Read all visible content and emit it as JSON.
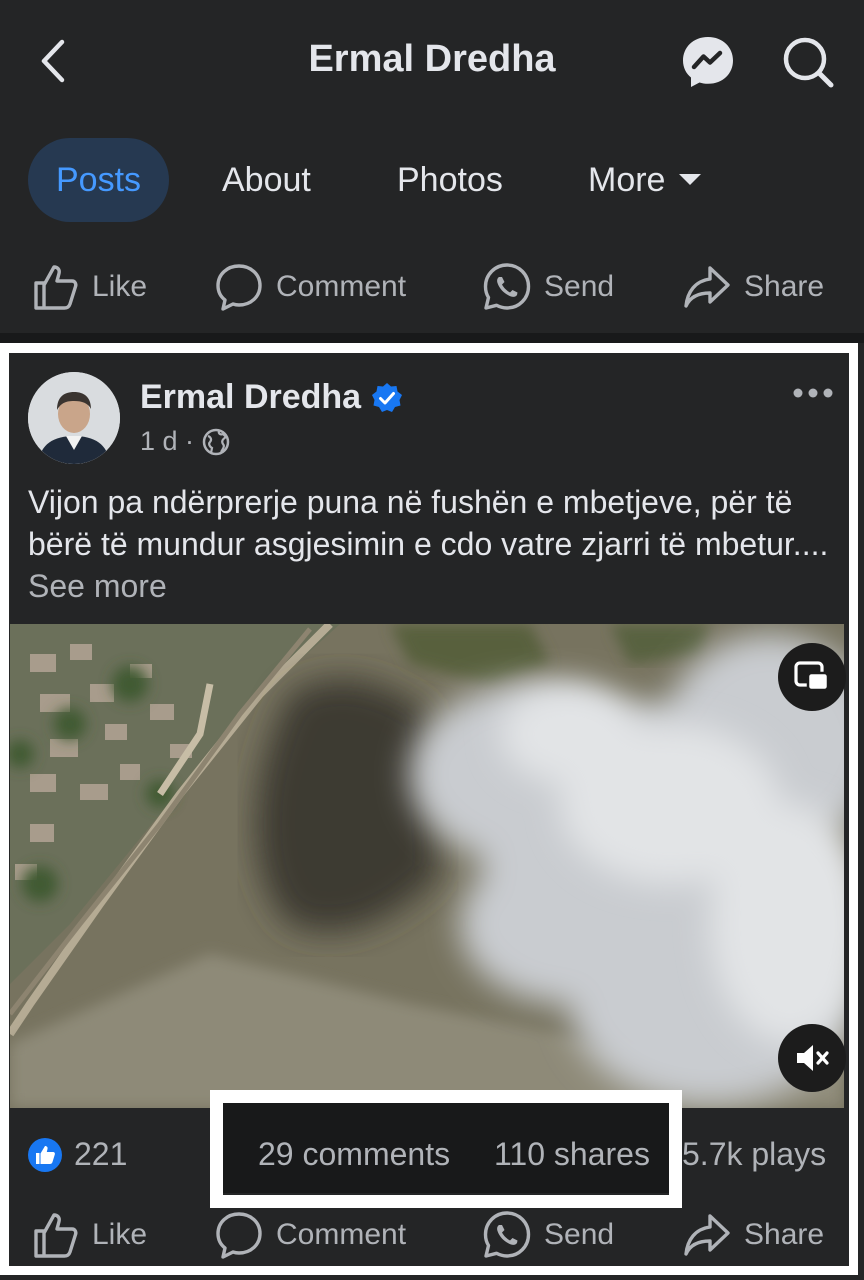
{
  "header": {
    "title": "Ermal Dredha",
    "back_icon": "chevron-left-icon",
    "messenger_icon": "messenger-icon",
    "search_icon": "search-icon"
  },
  "tabs": [
    {
      "label": "Posts",
      "active": true
    },
    {
      "label": "About",
      "active": false
    },
    {
      "label": "Photos",
      "active": false
    },
    {
      "label": "More",
      "active": false
    }
  ],
  "actions": {
    "like": "Like",
    "comment": "Comment",
    "send": "Send",
    "share": "Share"
  },
  "post": {
    "author": "Ermal Dredha",
    "verified": true,
    "time": "1 d",
    "visibility": "globe-icon",
    "text": "Vijon pa ndërprerje puna në fushën e mbetjeve, për të bërë të  mundur asgjesimin e cdo vatre zjarri të mbetur....",
    "see_more": "See more",
    "stats": {
      "likes": "221",
      "comments": "29 comments",
      "shares": "110 shares",
      "plays": "5.7k plays"
    }
  },
  "colors": {
    "background": "#242526",
    "active_tab_bg": "#263951",
    "active_tab_text": "#4599ff",
    "verified_blue": "#1877f2",
    "secondary_text": "#b0b3b8"
  }
}
